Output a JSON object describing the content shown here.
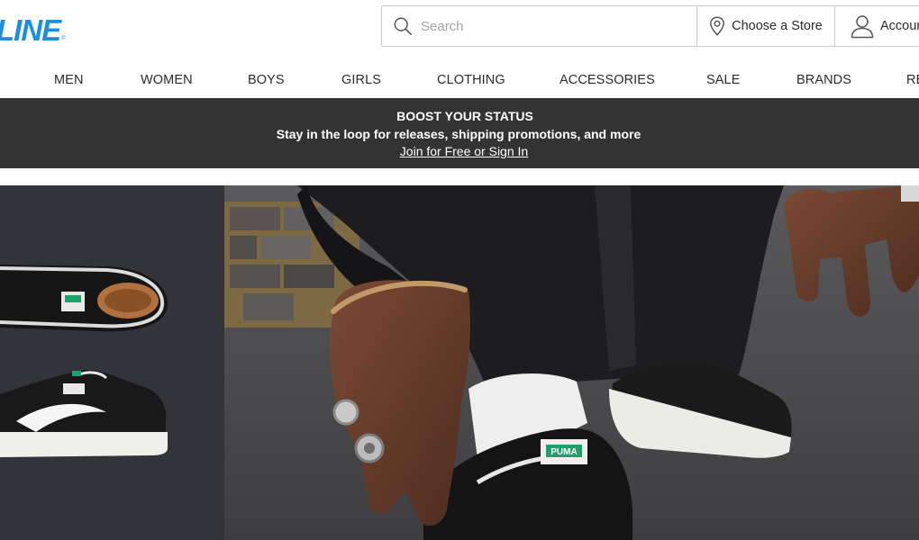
{
  "brand": {
    "logo_text": "LINE",
    "color": "#1c8fdc"
  },
  "search": {
    "placeholder": "Search",
    "icon": "search-icon"
  },
  "store": {
    "label": "Choose a Store",
    "icon": "location-pin-icon"
  },
  "account": {
    "label": "Account",
    "icon": "user-icon"
  },
  "nav": {
    "items": [
      {
        "label": "MEN"
      },
      {
        "label": "WOMEN"
      },
      {
        "label": "BOYS"
      },
      {
        "label": "GIRLS"
      },
      {
        "label": "CLOTHING"
      },
      {
        "label": "ACCESSORIES"
      },
      {
        "label": "SALE"
      },
      {
        "label": "BRANDS"
      },
      {
        "label": "RE"
      }
    ]
  },
  "promo": {
    "title": "BOOST YOUR STATUS",
    "subtitle": "Stay in the loop for releases, shipping promotions, and more",
    "link_label": "Join for Free or Sign In",
    "background": "#333333"
  },
  "hero": {
    "shoe_brand_text": "PUMA",
    "badge_color": "#1fa06b"
  }
}
